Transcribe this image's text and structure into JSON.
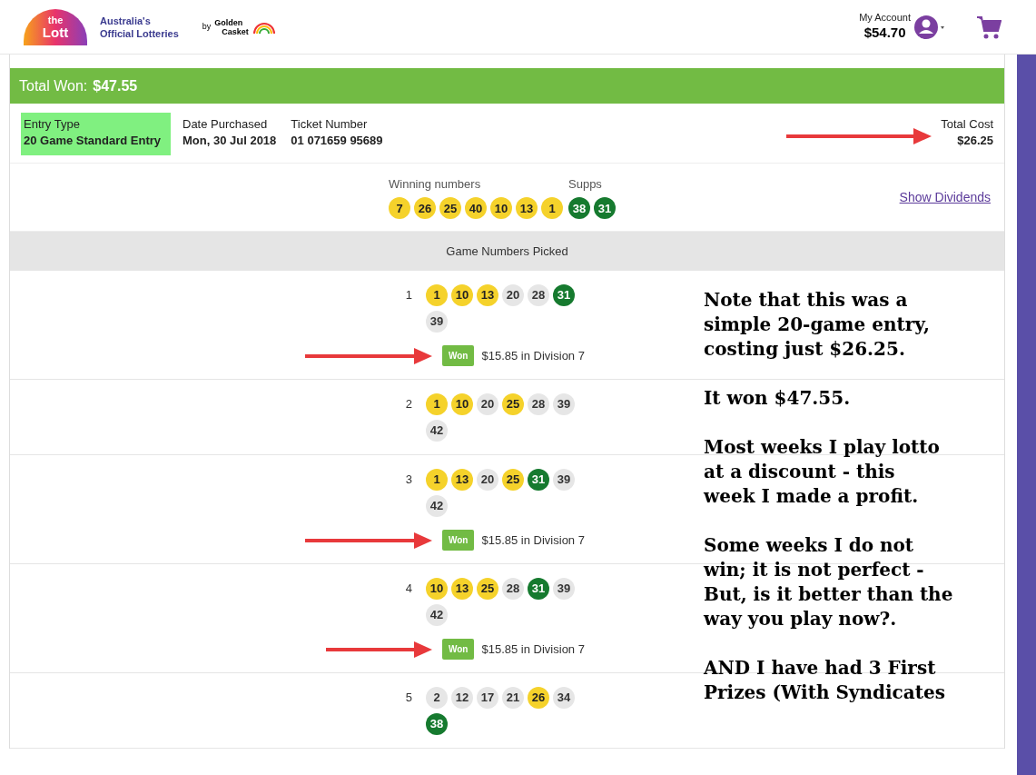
{
  "header": {
    "logo": {
      "line_1": "the",
      "line_2": "Lott",
      "tagline_1": "Australia's",
      "tagline_2": "Official Lotteries",
      "by": "by",
      "partner_1": "Golden",
      "partner_2": "Casket"
    },
    "account": {
      "label": "My Account",
      "balance": "$54.70"
    }
  },
  "summary": {
    "label": "Total Won:",
    "amount": "$47.55"
  },
  "details": [
    {
      "label": "Entry Type",
      "value": "20 Game Standard Entry",
      "highlighted": true
    },
    {
      "label": "Date Purchased",
      "value": "Mon, 30 Jul 2018",
      "highlighted": false
    },
    {
      "label": "Ticket Number",
      "value": "01 071659 95689",
      "highlighted": false
    }
  ],
  "total_cost": {
    "label": "Total Cost",
    "value": "$26.25"
  },
  "winning": {
    "label": "Winning numbers",
    "numbers": [
      "7",
      "26",
      "25",
      "40",
      "10",
      "13",
      "1"
    ],
    "supps_label": "Supps",
    "supps": [
      "38",
      "31"
    ],
    "link": "Show Dividends"
  },
  "games_header": "Game Numbers Picked",
  "games": [
    {
      "number": "1",
      "balls": [
        {
          "n": "1",
          "kind": "main"
        },
        {
          "n": "10",
          "kind": "main"
        },
        {
          "n": "13",
          "kind": "main"
        },
        {
          "n": "20",
          "kind": "none"
        },
        {
          "n": "28",
          "kind": "none"
        },
        {
          "n": "31",
          "kind": "supp"
        },
        {
          "n": "39",
          "kind": "none"
        }
      ],
      "won": true,
      "badge": "Won",
      "prize": "$15.85 in Division 7"
    },
    {
      "number": "2",
      "balls": [
        {
          "n": "1",
          "kind": "main"
        },
        {
          "n": "10",
          "kind": "main"
        },
        {
          "n": "20",
          "kind": "none"
        },
        {
          "n": "25",
          "kind": "main"
        },
        {
          "n": "28",
          "kind": "none"
        },
        {
          "n": "39",
          "kind": "none"
        },
        {
          "n": "42",
          "kind": "none"
        }
      ],
      "won": false
    },
    {
      "number": "3",
      "balls": [
        {
          "n": "1",
          "kind": "main"
        },
        {
          "n": "13",
          "kind": "main"
        },
        {
          "n": "20",
          "kind": "none"
        },
        {
          "n": "25",
          "kind": "main"
        },
        {
          "n": "31",
          "kind": "supp"
        },
        {
          "n": "39",
          "kind": "none"
        },
        {
          "n": "42",
          "kind": "none"
        }
      ],
      "won": true,
      "badge": "Won",
      "prize": "$15.85 in Division 7"
    },
    {
      "number": "4",
      "balls": [
        {
          "n": "10",
          "kind": "main"
        },
        {
          "n": "13",
          "kind": "main"
        },
        {
          "n": "25",
          "kind": "main"
        },
        {
          "n": "28",
          "kind": "none"
        },
        {
          "n": "31",
          "kind": "supp"
        },
        {
          "n": "39",
          "kind": "none"
        },
        {
          "n": "42",
          "kind": "none"
        }
      ],
      "won": true,
      "badge": "Won",
      "prize": "$15.85 in Division 7"
    },
    {
      "number": "5",
      "balls": [
        {
          "n": "2",
          "kind": "none"
        },
        {
          "n": "12",
          "kind": "none"
        },
        {
          "n": "17",
          "kind": "none"
        },
        {
          "n": "21",
          "kind": "none"
        },
        {
          "n": "26",
          "kind": "main"
        },
        {
          "n": "34",
          "kind": "none"
        },
        {
          "n": "38",
          "kind": "supp"
        }
      ],
      "won": false
    }
  ],
  "notes": [
    {
      "lines": [
        "Note that this was a",
        "simple 20-game entry,",
        "costing just $26.25."
      ]
    },
    {
      "lines": [
        "It won $47.55."
      ]
    },
    {
      "lines": [
        "Most weeks I play lotto",
        "at a discount - this",
        "week I made a profit."
      ]
    },
    {
      "lines": [
        "Some weeks I do not",
        "win; it is not perfect -",
        "But, is it better than the",
        "way you play now?."
      ]
    },
    {
      "lines": [
        "AND I have had 3 First",
        "Prizes (With Syndicates"
      ]
    }
  ]
}
